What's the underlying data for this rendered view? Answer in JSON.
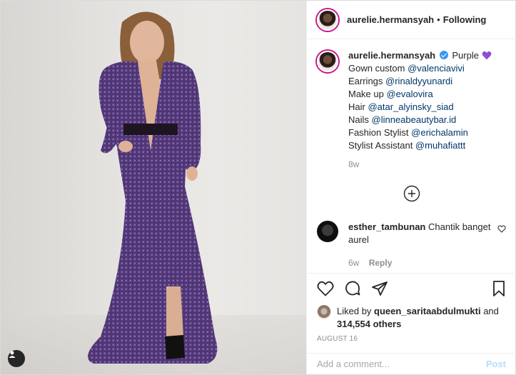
{
  "post": {
    "username": "aurelie.hermansyah",
    "follow_status": "Following",
    "follow_dot": "•",
    "caption": {
      "first_line_text": "Purple",
      "lines": [
        {
          "prefix": "Gown custom ",
          "mention": "@valenciavivi"
        },
        {
          "prefix": "Earrings ",
          "mention": "@rinaldyyunardi"
        },
        {
          "prefix": "Make up ",
          "mention": "@evalovira"
        },
        {
          "prefix": "Hair ",
          "mention": "@atar_alyinsky_siad"
        },
        {
          "prefix": "Nails ",
          "mention": "@linneabeautybar.id"
        },
        {
          "prefix": "Fashion Stylist ",
          "mention": "@erichalamin"
        },
        {
          "prefix": "Stylist Assistant ",
          "mention": "@muhafiattt"
        }
      ],
      "age": "8w"
    },
    "comment": {
      "username": "esther_tambunan",
      "text": "Chantik banget aurel",
      "age": "6w",
      "reply_label": "Reply"
    },
    "likes": {
      "prefix": "Liked by ",
      "user": "queen_saritaabdulmukti",
      "middle": " and ",
      "count": "314,554 others"
    },
    "date": "AUGUST 16",
    "add_comment_placeholder": "Add a comment...",
    "post_label": "Post"
  },
  "colors": {
    "verified": "#3897f0",
    "heart_purple": "#8a4fd6",
    "mention": "#00376b",
    "post_button_disabled": "#b2dffc"
  },
  "icons": [
    "tag-people-icon",
    "verified-badge-icon",
    "purple-heart-icon",
    "add-icon",
    "heart-icon",
    "comment-icon",
    "share-icon",
    "bookmark-icon"
  ]
}
